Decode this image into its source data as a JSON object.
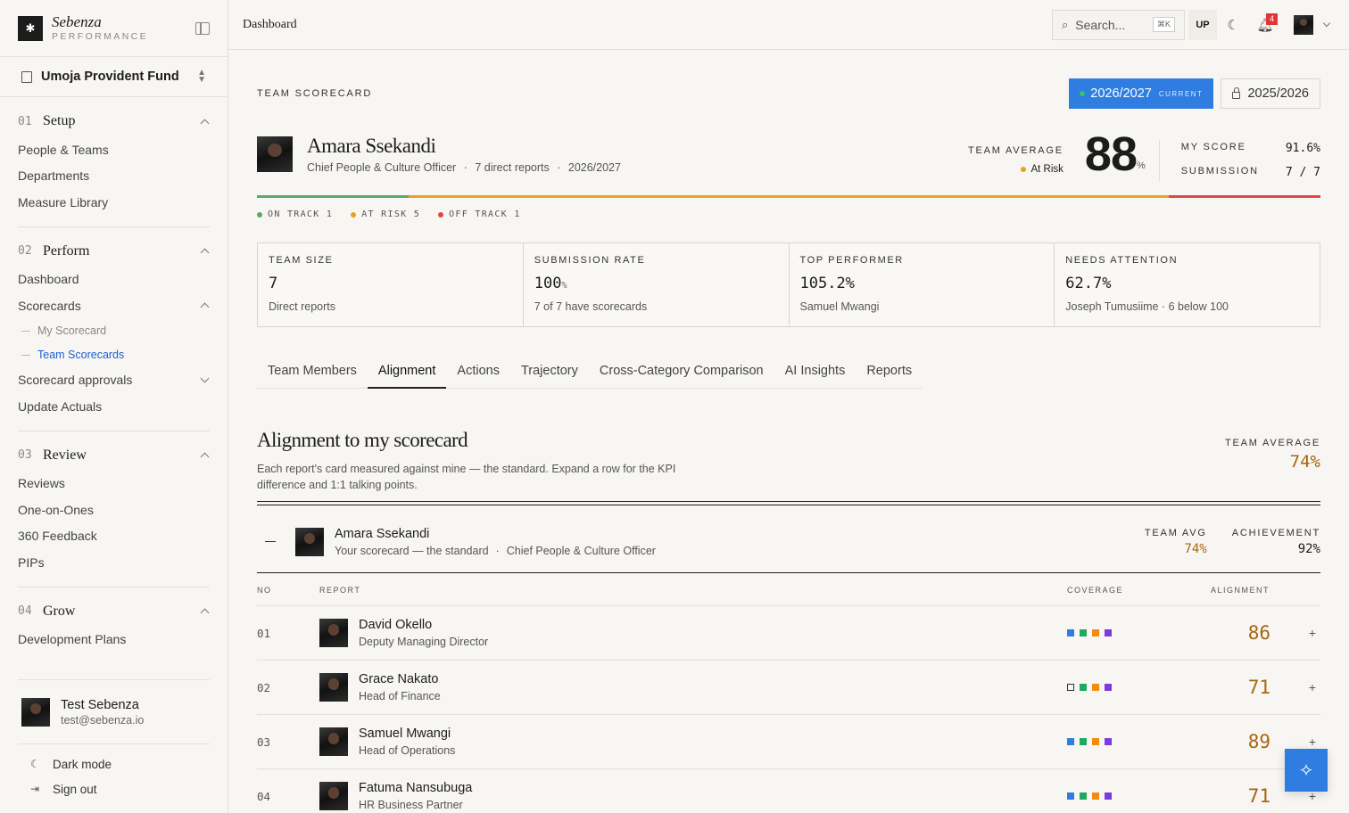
{
  "brand": {
    "name": "Sebenza",
    "sub": "PERFORMANCE"
  },
  "org": {
    "name": "Umoja Provident Fund"
  },
  "sidebar": {
    "sections": [
      {
        "num": "01",
        "title": "Setup",
        "items": [
          "People & Teams",
          "Departments",
          "Measure Library"
        ]
      },
      {
        "num": "02",
        "title": "Perform",
        "items": [
          "Dashboard",
          "Scorecards",
          "Scorecard approvals",
          "Update Actuals"
        ],
        "subitems": [
          "My Scorecard",
          "Team Scorecards"
        ]
      },
      {
        "num": "03",
        "title": "Review",
        "items": [
          "Reviews",
          "One-on-Ones",
          "360 Feedback",
          "PIPs"
        ]
      },
      {
        "num": "04",
        "title": "Grow",
        "items": [
          "Development Plans"
        ]
      }
    ],
    "user": {
      "name": "Test Sebenza",
      "email": "test@sebenza.io"
    },
    "footer": {
      "dark_mode": "Dark mode",
      "sign_out": "Sign out"
    }
  },
  "topbar": {
    "breadcrumb": "Dashboard",
    "search_placeholder": "Search...",
    "search_kbd": "⌘K",
    "user_initials": "UP",
    "notif_count": "4"
  },
  "header": {
    "eyebrow": "TEAM SCORECARD",
    "year_current": "2026/2027",
    "year_current_tag": "CURRENT",
    "year_prev": "2025/2026",
    "person_name": "Amara Ssekandi",
    "person_role": "Chief People & Culture Officer",
    "person_reports": "7 direct reports",
    "person_year": "2026/2027",
    "team_avg_label": "TEAM AVERAGE",
    "team_avg_status": "At Risk",
    "team_avg_value": "88",
    "team_avg_unit": "%",
    "my_score_label": "MY SCORE",
    "my_score_value": "91.6%",
    "submission_label": "SUBMISSION",
    "submission_value": "7 / 7"
  },
  "status_legend": {
    "on_track": "ON TRACK 1",
    "at_risk": "AT RISK 5",
    "off_track": "OFF TRACK 1",
    "counts": {
      "on_track": 1,
      "at_risk": 5,
      "off_track": 1
    }
  },
  "stats": [
    {
      "label": "TEAM SIZE",
      "value": "7",
      "unit": "",
      "sub": "Direct reports"
    },
    {
      "label": "SUBMISSION RATE",
      "value": "100",
      "unit": "%",
      "sub": "7 of 7 have scorecards"
    },
    {
      "label": "TOP PERFORMER",
      "value": "105.2%",
      "unit": "",
      "sub": "Samuel Mwangi"
    },
    {
      "label": "NEEDS ATTENTION",
      "value": "62.7%",
      "unit": "",
      "sub": "Joseph Tumusiime · 6 below 100"
    }
  ],
  "tabs": [
    "Team Members",
    "Alignment",
    "Actions",
    "Trajectory",
    "Cross-Category Comparison",
    "AI Insights",
    "Reports"
  ],
  "alignment": {
    "title": "Alignment to my scorecard",
    "desc": "Each report's card measured against mine — the standard. Expand a row for the KPI difference and 1:1 talking points.",
    "team_avg_label": "TEAM AVERAGE",
    "team_avg_value": "74%",
    "standard": {
      "name": "Amara Ssekandi",
      "sub": "Your scorecard — the standard",
      "role": "Chief People & Culture Officer",
      "team_avg_label": "TEAM AVG",
      "team_avg_value": "74%",
      "achievement_label": "ACHIEVEMENT",
      "achievement_value": "92%"
    },
    "columns": {
      "no": "NO",
      "report": "REPORT",
      "coverage": "COVERAGE",
      "alignment": "ALIGNMENT"
    },
    "rows": [
      {
        "no": "01",
        "name": "David Okello",
        "role": "Deputy Managing Director",
        "coverage": [
          true,
          true,
          true,
          true
        ],
        "score": "86"
      },
      {
        "no": "02",
        "name": "Grace Nakato",
        "role": "Head of Finance",
        "coverage": [
          false,
          true,
          true,
          true
        ],
        "score": "71"
      },
      {
        "no": "03",
        "name": "Samuel Mwangi",
        "role": "Head of Operations",
        "coverage": [
          true,
          true,
          true,
          true
        ],
        "score": "89"
      },
      {
        "no": "04",
        "name": "Fatuma Nansubuga",
        "role": "HR Business Partner",
        "coverage": [
          true,
          true,
          true,
          true
        ],
        "score": "71"
      }
    ]
  },
  "colors": {
    "accent": "#2f7de1",
    "on_track": "#5aa86b",
    "at_risk": "#e8a21f",
    "off_track": "#e04646",
    "score": "#a8650f",
    "coverage": [
      "#2f7de1",
      "#1ea862",
      "#f08c12",
      "#7c3ae0"
    ]
  }
}
